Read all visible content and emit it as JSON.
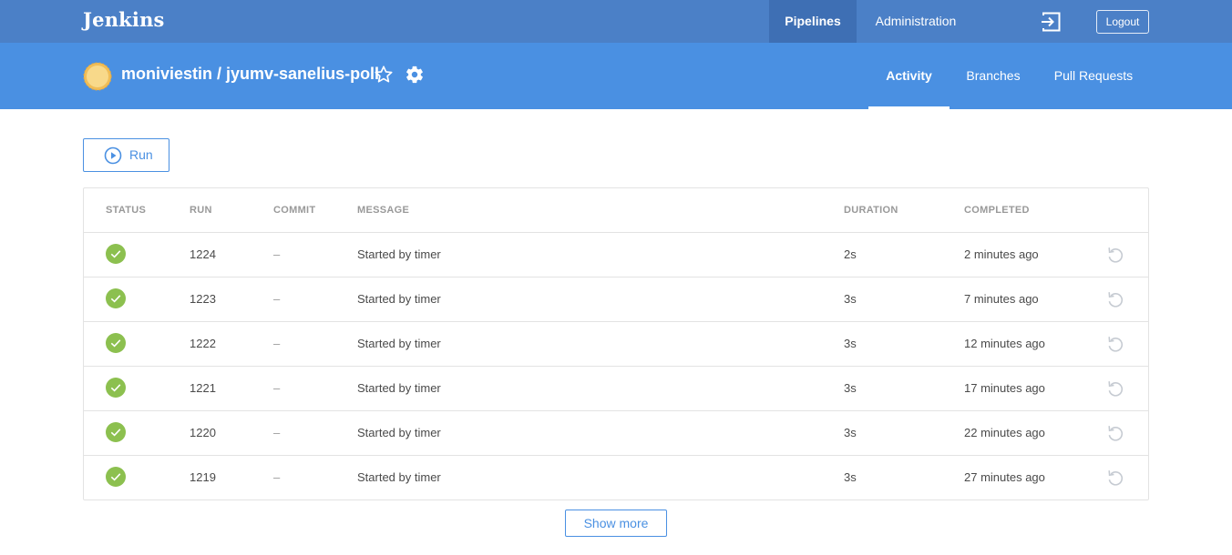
{
  "app": {
    "logo": "Jenkins",
    "nav": {
      "pipelines": "Pipelines",
      "administration": "Administration"
    },
    "logout": "Logout"
  },
  "pipeline": {
    "title": "moniviestin / jyumv-sanelius-poll",
    "tabs": {
      "activity": "Activity",
      "branches": "Branches",
      "pull_requests": "Pull Requests"
    }
  },
  "toolbar": {
    "run_label": "Run"
  },
  "table": {
    "headers": {
      "status": "STATUS",
      "run": "RUN",
      "commit": "COMMIT",
      "message": "MESSAGE",
      "duration": "DURATION",
      "completed": "COMPLETED"
    },
    "rows": [
      {
        "status": "success",
        "run": "1224",
        "commit": "–",
        "message": "Started by timer",
        "duration": "2s",
        "completed": "2 minutes ago"
      },
      {
        "status": "success",
        "run": "1223",
        "commit": "–",
        "message": "Started by timer",
        "duration": "3s",
        "completed": "7 minutes ago"
      },
      {
        "status": "success",
        "run": "1222",
        "commit": "–",
        "message": "Started by timer",
        "duration": "3s",
        "completed": "12 minutes ago"
      },
      {
        "status": "success",
        "run": "1221",
        "commit": "–",
        "message": "Started by timer",
        "duration": "3s",
        "completed": "17 minutes ago"
      },
      {
        "status": "success",
        "run": "1220",
        "commit": "–",
        "message": "Started by timer",
        "duration": "3s",
        "completed": "22 minutes ago"
      },
      {
        "status": "success",
        "run": "1219",
        "commit": "–",
        "message": "Started by timer",
        "duration": "3s",
        "completed": "27 minutes ago"
      }
    ]
  },
  "show_more": "Show more",
  "colors": {
    "topbar": "#4b80c7",
    "subbar": "#4a90e2",
    "accent": "#4a90e2",
    "success": "#8cc04f"
  }
}
